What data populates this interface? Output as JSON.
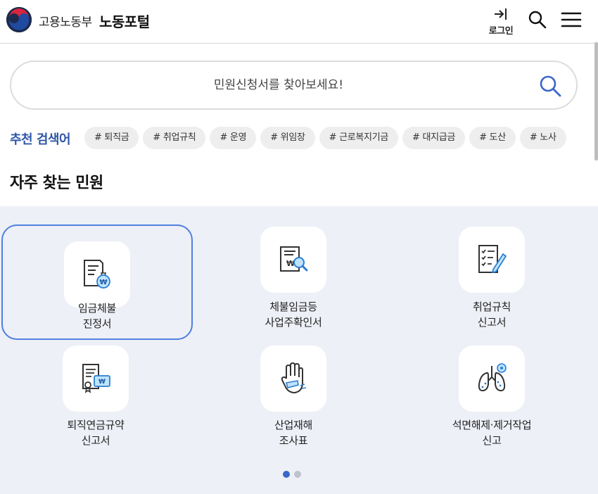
{
  "header": {
    "ministry": "고용노동부",
    "portal": "노동포털",
    "login_label": "로그인"
  },
  "search": {
    "placeholder": "민원신청서를 찾아보세요!"
  },
  "recommended": {
    "label": "추천 검색어",
    "keywords": [
      "# 퇴직금",
      "# 취업규칙",
      "# 운영",
      "# 위임장",
      "# 근로복지기금",
      "# 대지급금",
      "# 도산",
      "# 노사"
    ]
  },
  "section": {
    "title": "자주 찾는 민원"
  },
  "cards": [
    {
      "line1": "임금체불",
      "line2": "진정서",
      "icon": "wage-document-icon"
    },
    {
      "line1": "체불임금등",
      "line2": "사업주확인서",
      "icon": "document-magnifier-icon"
    },
    {
      "line1": "취업규칙",
      "line2": "신고서",
      "icon": "checklist-pen-icon"
    },
    {
      "line1": "퇴직연금규약",
      "line2": "신고서",
      "icon": "pension-certificate-icon"
    },
    {
      "line1": "산업재해",
      "line2": "조사표",
      "icon": "injured-hand-icon"
    },
    {
      "line1": "석면해제·제거작업",
      "line2": "신고",
      "icon": "lungs-icon"
    }
  ],
  "pagination": {
    "current": 1,
    "total": 2
  },
  "colors": {
    "accent": "#2f56a8",
    "selected_border": "#4f7fe0",
    "grid_bg": "#eef0f7"
  }
}
